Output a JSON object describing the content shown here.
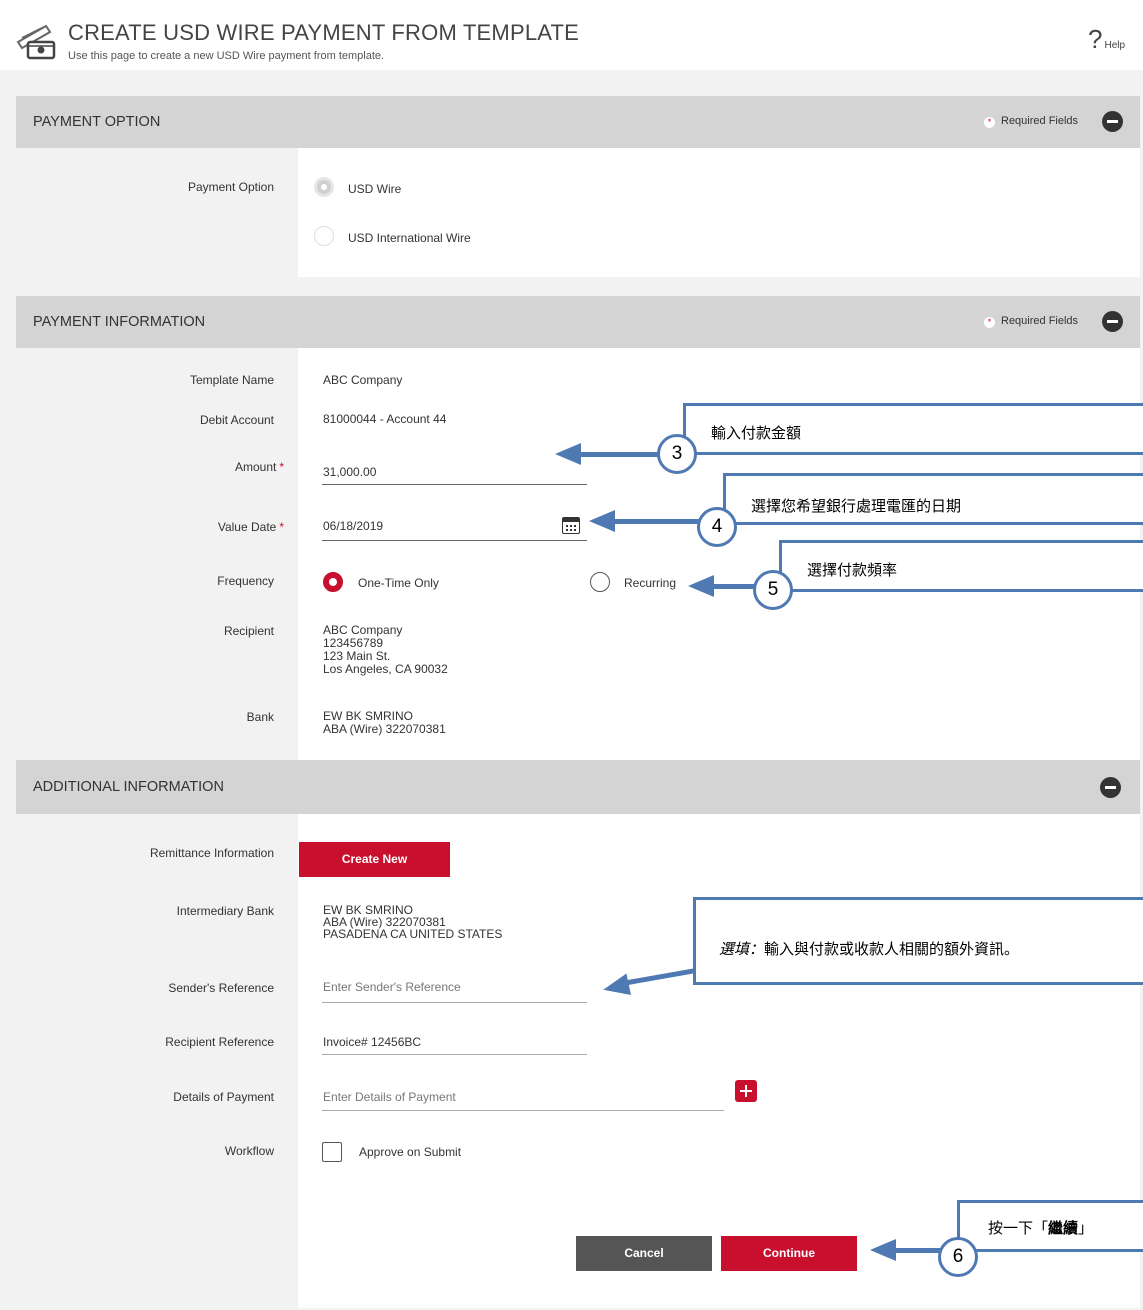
{
  "header": {
    "title": "CREATE USD WIRE PAYMENT FROM TEMPLATE",
    "subtitle": "Use this page to create a new USD Wire payment from template.",
    "help_symbol": "?",
    "help_label": "Help"
  },
  "payment_option": {
    "section_title": "PAYMENT OPTION",
    "required_text": "Required Fields",
    "required_star": "*",
    "field_label": "Payment Option",
    "options": [
      "USD Wire",
      "USD International Wire"
    ],
    "selected": "USD Wire"
  },
  "payment_information": {
    "section_title": "PAYMENT INFORMATION",
    "required_text": "Required Fields",
    "required_star": "*",
    "template_name_label": "Template Name",
    "template_name": "ABC Company",
    "debit_account_label": "Debit Account",
    "debit_account": "81000044 - Account 44",
    "amount_label": "Amount",
    "amount_value": "31,000.00",
    "value_date_label": "Value Date",
    "value_date": "06/18/2019",
    "required_mark": "*",
    "frequency_label": "Frequency",
    "frequency_options": [
      "One-Time Only",
      "Recurring"
    ],
    "frequency_selected": "One-Time Only",
    "recipient_label": "Recipient",
    "recipient_lines": [
      "ABC Company",
      "123456789",
      "123 Main St.",
      "Los Angeles, CA 90032"
    ],
    "bank_label": "Bank",
    "bank_lines": [
      "EW BK SMRINO",
      "ABA (Wire) 322070381"
    ]
  },
  "additional_information": {
    "section_title": "ADDITIONAL INFORMATION",
    "remittance_label": "Remittance Information",
    "create_new_label": "Create New",
    "intermediary_label": "Intermediary Bank",
    "intermediary_lines": [
      "EW BK SMRINO",
      "ABA (Wire) 322070381",
      "PASADENA CA UNITED STATES"
    ],
    "sender_ref_label": "Sender's Reference",
    "sender_ref_placeholder": "Enter Sender's Reference",
    "recipient_ref_label": "Recipient Reference",
    "recipient_ref_value": "Invoice# 12456BC",
    "details_label": "Details of Payment",
    "details_placeholder": "Enter Details of Payment",
    "workflow_label": "Workflow",
    "approve_label": "Approve on Submit"
  },
  "actions": {
    "cancel_label": "Cancel",
    "continue_label": "Continue"
  },
  "callouts": {
    "c3_number": "3",
    "c3_text": "輸入付款金額",
    "c4_number": "4",
    "c4_text": "選擇您希望銀行處理電匯的日期",
    "c5_number": "5",
    "c5_text": "選擇付款頻率",
    "optional_italic": "選填：",
    "optional_text": "輸入與付款或收款人相關的額外資訊。",
    "c6_number": "6",
    "c6_text_pre": "按一下「",
    "c6_text_bold": "繼續",
    "c6_text_post": "」"
  },
  "colors": {
    "accent_red": "#c8102e",
    "callout_blue": "#4f79b3",
    "header_grey": "#d4d4d4"
  }
}
